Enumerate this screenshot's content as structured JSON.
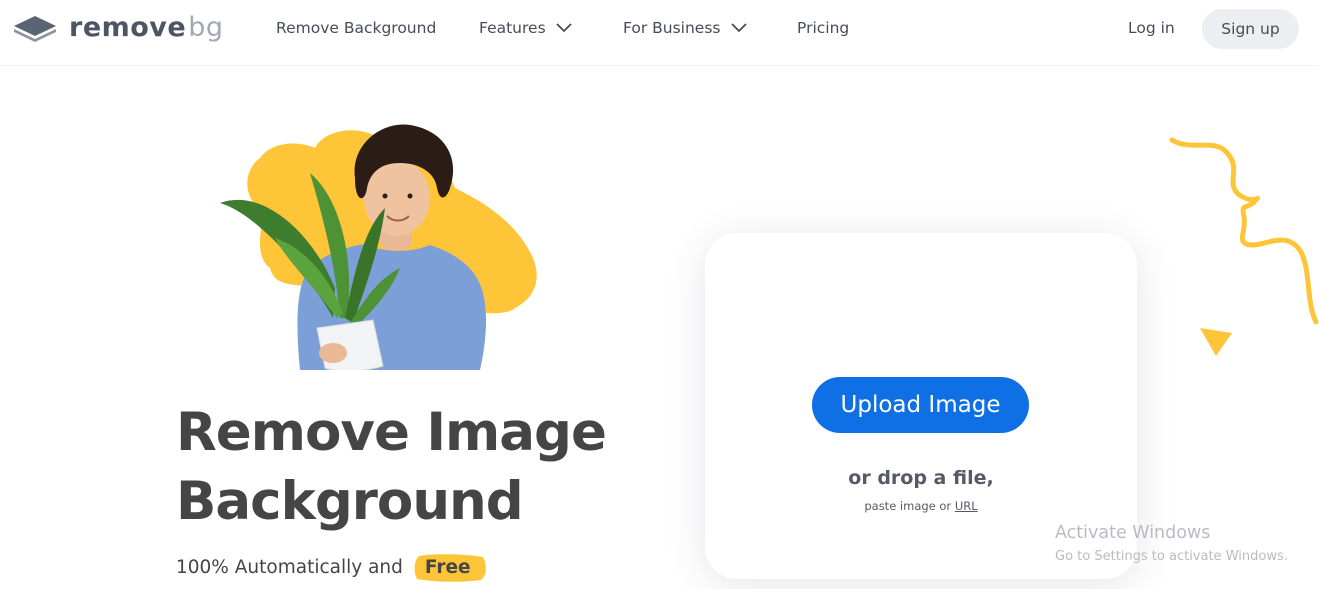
{
  "header": {
    "logo": {
      "word1": "remove",
      "word2": "bg"
    },
    "nav": [
      {
        "label": "Remove Background",
        "has_dropdown": false
      },
      {
        "label": "Features",
        "has_dropdown": true
      },
      {
        "label": "For Business",
        "has_dropdown": true
      },
      {
        "label": "Pricing",
        "has_dropdown": false
      }
    ],
    "login_label": "Log in",
    "signup_label": "Sign up"
  },
  "hero": {
    "title_line1": "Remove Image",
    "title_line2": "Background",
    "subtitle": "100% Automatically and",
    "badge": "Free"
  },
  "upload": {
    "button_label": "Upload Image",
    "drop_text": "or drop a file,",
    "paste_prefix": "paste image or",
    "url_link": "URL"
  },
  "watermark": {
    "title": "Activate Windows",
    "subtitle": "Go to Settings to activate Windows."
  },
  "colors": {
    "accent": "#0f70e6",
    "brand_yellow": "#ffc539",
    "text_dark": "#454545"
  },
  "icons": [
    "removebg-logo-icon",
    "chevron-down-icon",
    "squiggle-decoration",
    "triangle-decoration"
  ]
}
